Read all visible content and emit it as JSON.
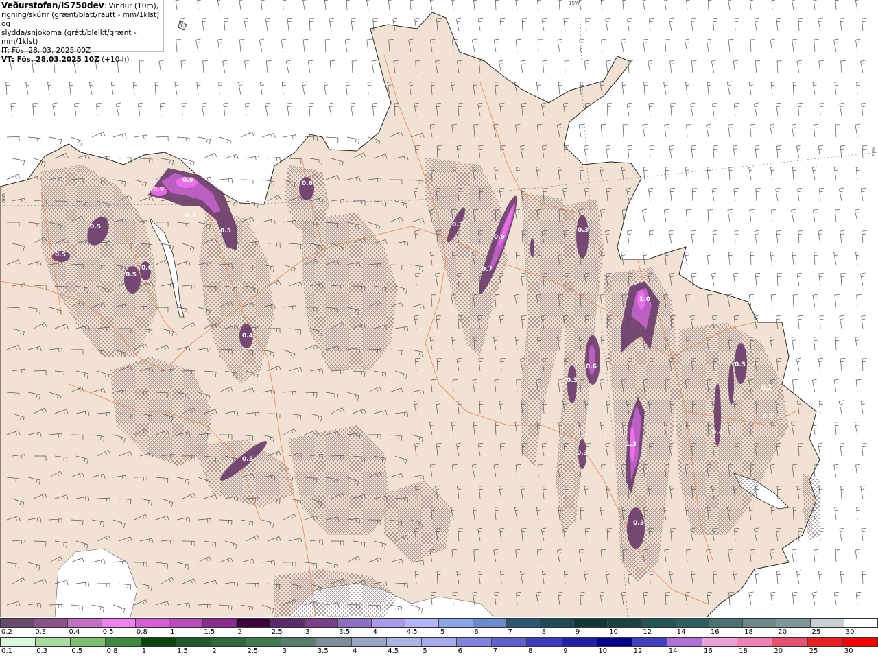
{
  "header": {
    "title": "Veðurstofan/IS750dev",
    "title_suffix": ": Vindur (10m),",
    "line2": "rigning/skúrir (grænt/blátt/rautt - mm/1klst) og",
    "line3": "slydda/snjókoma (grátt/bleikt/grænt - mm/1klst)",
    "it": "IT: Fös. 28. 03. 2025 00Z",
    "vt_bold": "VT: Fös. 28.03.2025 10Z",
    "vt_rest": " (+10 h)"
  },
  "grid_labels": {
    "lon": "15W",
    "lat_left": "66N",
    "lat_right": "66N"
  },
  "precip_labels": [
    "0.9",
    "0.9",
    "0.3",
    "0.5",
    "0.5",
    "0.5",
    "0.5",
    "0.6",
    "0.4",
    "0.6",
    "0.3",
    "0.3",
    "0.9",
    "0.7",
    "0.3",
    "1.0",
    "0.6",
    "0.3",
    "0.3",
    "1.3",
    "0.3",
    "0.3",
    "0.4",
    "0.2",
    "0.2"
  ],
  "legend_snow": {
    "labels": [
      "0.2",
      "0.3",
      "0.4",
      "0.5",
      "0.8",
      "1",
      "1.5",
      "2",
      "2.5",
      "3",
      "3.5",
      "4",
      "4.5",
      "5",
      "6",
      "7",
      "8",
      "9",
      "10",
      "12",
      "14",
      "16",
      "18",
      "20",
      "25",
      "30"
    ],
    "colors": [
      "#6a4a6a",
      "#8b528b",
      "#c070c0",
      "#f080f0",
      "#d85cd8",
      "#b84cb8",
      "#8c2c8c",
      "#3c003c",
      "#5e2a6e",
      "#7a3e8a",
      "#8e6ec2",
      "#a89ae8",
      "#b4b4f8",
      "#8aa4e8",
      "#6a8ccc",
      "#2c5874",
      "#1e4a5a",
      "#0c3838",
      "#184444",
      "#245454",
      "#2e5e5e",
      "#4a7272",
      "#6c8888",
      "#7e9696",
      "#c8d0d4",
      "#ffffff"
    ]
  },
  "legend_rain": {
    "labels": [
      "0.1",
      "0.3",
      "0.5",
      "0.8",
      "1",
      "1.5",
      "2",
      "2.5",
      "3",
      "3.5",
      "4",
      "4.5",
      "5",
      "6",
      "7",
      "8",
      "9",
      "10",
      "12",
      "14",
      "16",
      "18",
      "20",
      "25",
      "30"
    ],
    "colors": [
      "#dcf8dc",
      "#a8dca0",
      "#7cc070",
      "#3e8a3e",
      "#0a460a",
      "#1e5a2e",
      "#2e6a3e",
      "#3e7a4e",
      "#587e6e",
      "#7c8c98",
      "#9aa4c4",
      "#b0b4e4",
      "#a8a8ec",
      "#8484e0",
      "#6060d0",
      "#3c3cc0",
      "#2020a8",
      "#00008c",
      "#4040c0",
      "#b070d8",
      "#f0a0d8",
      "#f080b0",
      "#e85070",
      "#e82020",
      "#ff0000"
    ]
  }
}
